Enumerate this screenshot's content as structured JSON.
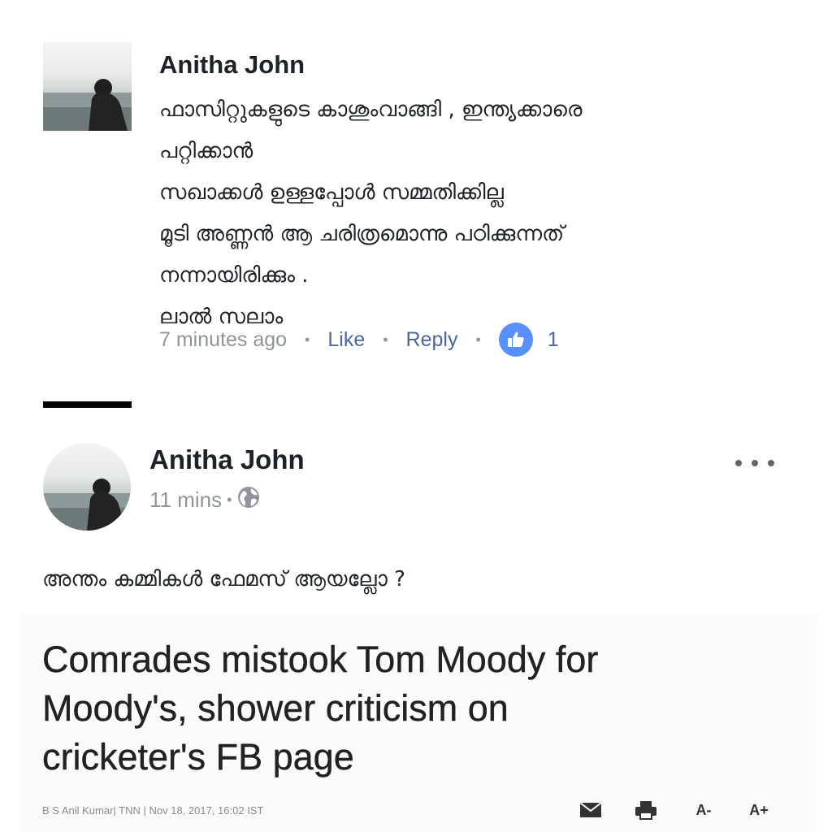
{
  "comment": {
    "author": "Anitha John",
    "lines": [
      "ഫാസിറ്റുകളുടെ കാശുംവാങ്ങി , ഇന്ത്യക്കാരെ",
      "പറ്റിക്കാൻ",
      "സഖാക്കൾ ഉള്ളപ്പോൾ സമ്മതിക്കില്ല",
      "മൂടി അണ്ണൻ ആ ചരിത്രമൊന്നു പഠിക്കുന്നത്",
      "നന്നായിരിക്കും .",
      "ലാൽ സലാം"
    ],
    "time": "7 minutes ago",
    "like_label": "Like",
    "reply_label": "Reply",
    "like_count": "1",
    "like_icon": "thumbs-up-icon",
    "accent_color": "#5890ff",
    "link_color": "#4b67a1"
  },
  "post": {
    "author": "Anitha John",
    "time": "11 mins",
    "privacy_icon": "globe-icon",
    "more_icon": "more-options-icon",
    "text": "അന്തം കമ്മികൾ ഫേമസ് ആയല്ലോ ?"
  },
  "article": {
    "headline_lines": [
      "Comrades mistook Tom Moody for",
      "Moody's, shower criticism on",
      "cricketer's FB page"
    ],
    "byline": "B S Anil Kumar| TNN | Nov 18, 2017, 16:02 IST",
    "tools": {
      "mail_icon": "mail-icon",
      "print_icon": "print-icon",
      "font_decrease": "A-",
      "font_increase": "A+"
    }
  }
}
